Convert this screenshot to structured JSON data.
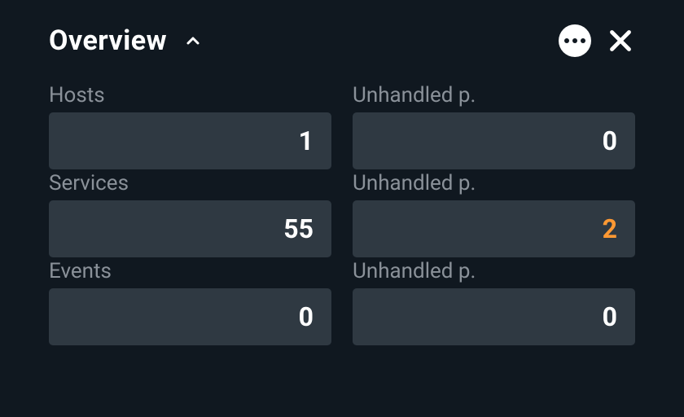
{
  "header": {
    "title": "Overview"
  },
  "stats": {
    "hosts": {
      "label": "Hosts",
      "value": "1"
    },
    "hosts_unhandled": {
      "label": "Unhandled p.",
      "value": "0"
    },
    "services": {
      "label": "Services",
      "value": "55"
    },
    "services_unhandled": {
      "label": "Unhandled p.",
      "value": "2"
    },
    "events": {
      "label": "Events",
      "value": "0"
    },
    "events_unhandled": {
      "label": "Unhandled p.",
      "value": "0"
    }
  }
}
